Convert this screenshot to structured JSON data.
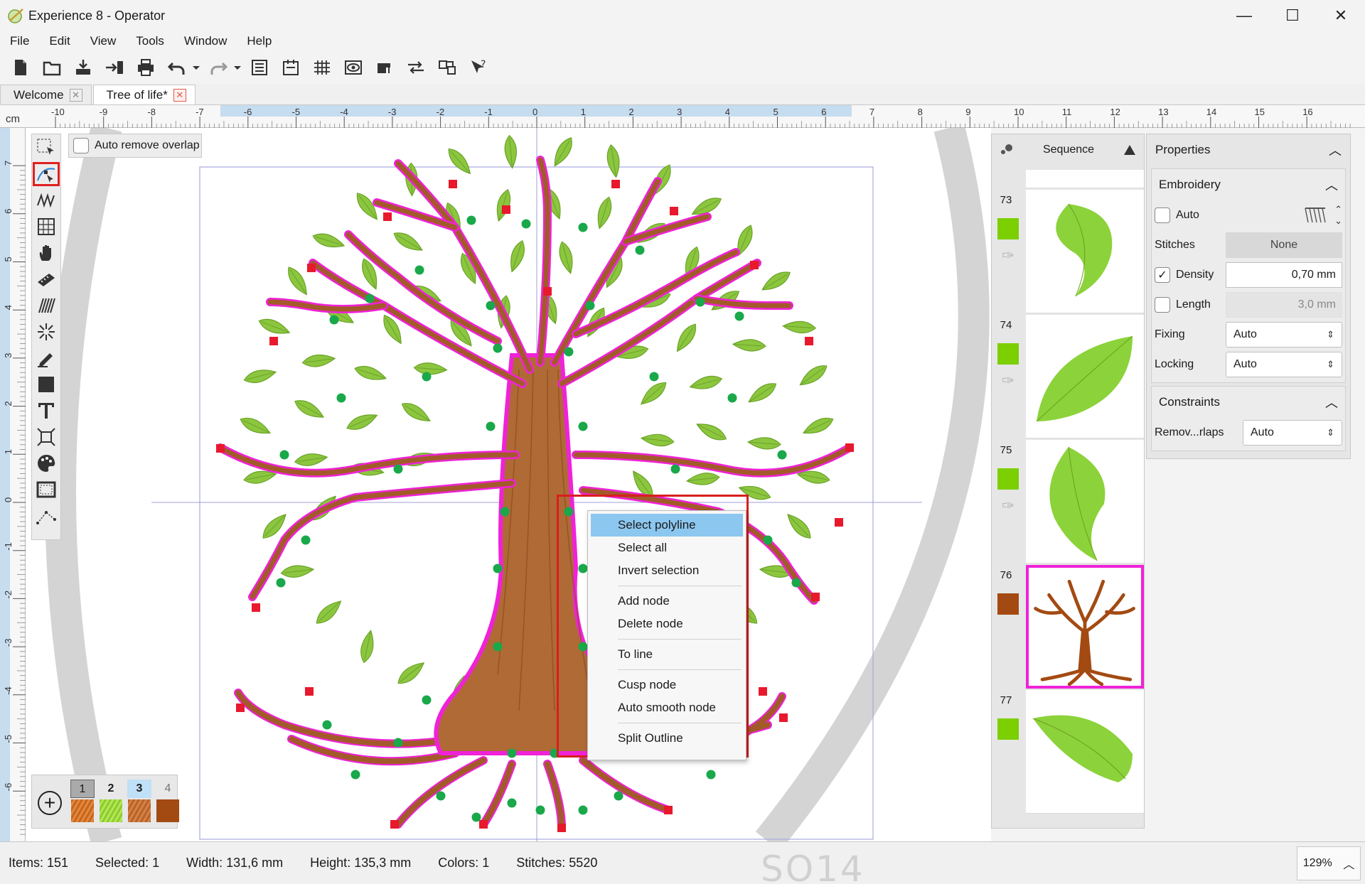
{
  "window": {
    "title": "Experience 8 - Operator",
    "controls": [
      "—",
      "☐",
      "✕"
    ]
  },
  "menu": [
    "File",
    "Edit",
    "View",
    "Tools",
    "Window",
    "Help"
  ],
  "tabs": [
    {
      "label": "Welcome",
      "active": false
    },
    {
      "label": "Tree of life*",
      "active": true
    }
  ],
  "ruler": {
    "unit": "cm",
    "top_ticks": [
      "-10",
      "-9",
      "-8",
      "-7",
      "-6",
      "-5",
      "-4",
      "-3",
      "-2",
      "-1",
      "0",
      "1",
      "2",
      "3",
      "4",
      "5",
      "6",
      "7",
      "8",
      "9",
      "10",
      "11",
      "12",
      "13",
      "14",
      "15",
      "16"
    ],
    "left_ticks": [
      "7",
      "6",
      "5",
      "4",
      "3",
      "2",
      "1",
      "0",
      "-1",
      "-2",
      "-3",
      "-4",
      "-5",
      "-6"
    ]
  },
  "canvas": {
    "auto_remove_overlap_label": "Auto remove overlap",
    "auto_remove_overlap_checked": false
  },
  "colors": {
    "swatches": [
      {
        "num": "1",
        "color": "#c8641e"
      },
      {
        "num": "2",
        "color": "#8ccc2c"
      },
      {
        "num": "3",
        "color": "#b8622a"
      },
      {
        "num": "4",
        "color": "#a34a12"
      }
    ],
    "accent_magenta": "#f022d8",
    "leaf_green": "#8cc63f",
    "trunk_brown": "#a35a2a"
  },
  "sequence": {
    "title": "Sequence",
    "items": [
      {
        "num": "73",
        "color": "#7ccf00",
        "thumb": "leaf"
      },
      {
        "num": "74",
        "color": "#7ccf00",
        "thumb": "leaf"
      },
      {
        "num": "75",
        "color": "#7ccf00",
        "thumb": "leaf"
      },
      {
        "num": "76",
        "color": "#a34a12",
        "thumb": "tree",
        "selected": true
      },
      {
        "num": "77",
        "color": "#7ccf00",
        "thumb": "leaf"
      }
    ]
  },
  "properties": {
    "title": "Properties",
    "embroidery": {
      "title": "Embroidery",
      "auto_label": "Auto",
      "stitches_label": "Stitches",
      "stitches_value": "None",
      "density_label": "Density",
      "density_checked": true,
      "density_value": "0,70 mm",
      "length_label": "Length",
      "length_checked": false,
      "length_value": "3,0 mm",
      "fixing_label": "Fixing",
      "fixing_value": "Auto",
      "locking_label": "Locking",
      "locking_value": "Auto"
    },
    "constraints": {
      "title": "Constraints",
      "remove_overlaps_label": "Remov...rlaps",
      "remove_overlaps_value": "Auto"
    }
  },
  "context_menu": {
    "items": [
      "Select polyline",
      "Select all",
      "Invert selection",
      "Add node",
      "Delete node",
      "To line",
      "Cusp node",
      "Auto smooth node",
      "Split Outline"
    ],
    "highlighted": "Select polyline"
  },
  "status": {
    "items": "Items: 151",
    "selected": "Selected: 1",
    "width": "Width: 131,6 mm",
    "height": "Height: 135,3 mm",
    "colors": "Colors: 1",
    "stitches": "Stitches: 5520",
    "zoom": "129%",
    "watermark": "SO14"
  }
}
